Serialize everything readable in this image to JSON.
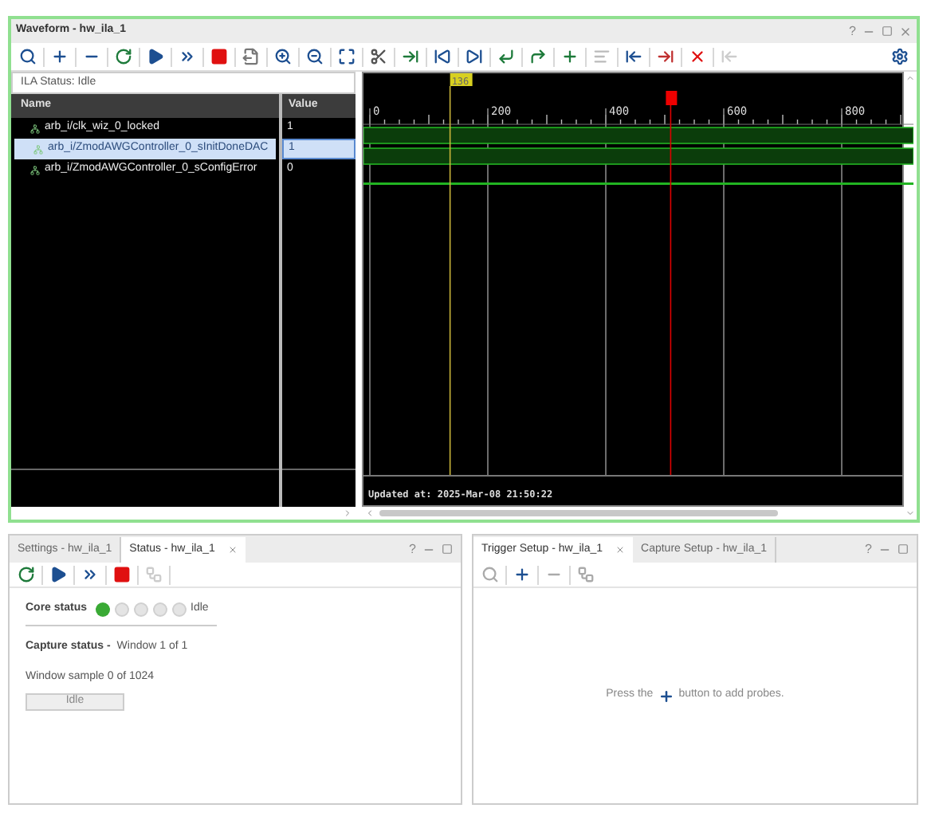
{
  "waveform_window": {
    "title": "Waveform - hw_ila_1",
    "help": "?",
    "ila_status": "ILA Status:  Idle",
    "columns": [
      "Name",
      "Value"
    ],
    "signals": [
      {
        "name": "arb_i/clk_wiz_0_locked",
        "value": "1",
        "selected": false,
        "high": true
      },
      {
        "name": "arb_i/ZmodAWGController_0_sInitDoneDAC",
        "value": "1",
        "selected": true,
        "high": true
      },
      {
        "name": "arb_i/ZmodAWGController_0_sConfigError",
        "value": "0",
        "selected": false,
        "high": false
      }
    ],
    "ruler": [
      "0",
      "200",
      "400",
      "600",
      "800"
    ],
    "cursor": "136",
    "updated": "Updated at: 2025-Mar-08 21:50:22"
  },
  "status_panel": {
    "tabs": [
      {
        "label": "Settings - hw_ila_1",
        "selected": false
      },
      {
        "label": "Status - hw_ila_1",
        "selected": true
      }
    ],
    "help": "?",
    "core_status_label": "Core status",
    "lights": [
      {
        "on": true
      },
      {
        "on": false
      },
      {
        "on": false
      },
      {
        "on": false
      },
      {
        "on": false
      }
    ],
    "core_status": "Idle",
    "capture_label": "Capture status -",
    "capture_value": "Window 1 of 1",
    "sample": "Window sample 0 of 1024",
    "state_button": "Idle"
  },
  "trigger_panel": {
    "tabs": [
      {
        "label": "Trigger Setup - hw_ila_1",
        "selected": true
      },
      {
        "label": "Capture Setup - hw_ila_1",
        "selected": false
      }
    ],
    "help": "?",
    "hint_before": "Press the",
    "hint_after": "button to add probes."
  }
}
